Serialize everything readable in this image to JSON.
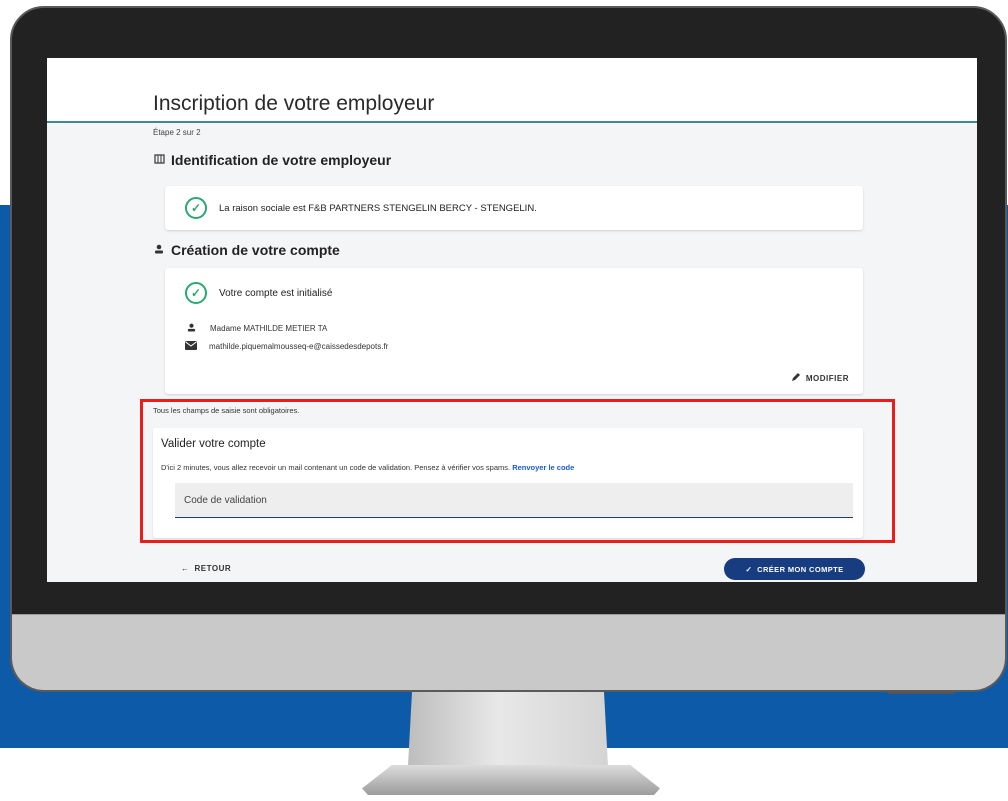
{
  "page": {
    "title": "Inscription de votre employeur",
    "step": "Étape 2 sur 2"
  },
  "employer_section": {
    "title": "Identification de votre employeur",
    "icon": "building-icon",
    "message": "La raison sociale est F&B PARTNERS STENGELIN BERCY - STENGELIN."
  },
  "account_section": {
    "title": "Création de votre compte",
    "icon": "user-icon",
    "status": "Votre compte est initialisé",
    "name": "Madame MATHILDE METIER TA",
    "email": "mathilde.piquemalmousseq-e@caissedesdepots.fr",
    "modify_label": "MODIFIER"
  },
  "validation_section": {
    "required_note": "Tous les champs de saisie sont obligatoires.",
    "title": "Valider votre compte",
    "description": "D'ici 2 minutes, vous allez recevoir un mail contenant un code de validation. Pensez à vérifier vos spams.",
    "resend_label": "Renvoyer le code",
    "code_placeholder": "Code de validation"
  },
  "actions": {
    "back_label": "RETOUR",
    "create_label": "CRÉER MON COMPTE"
  },
  "colors": {
    "accent_blue": "#0d5aa8",
    "primary_button": "#173d80",
    "success_green": "#2aa872",
    "highlight_red": "#ee1b1b"
  }
}
